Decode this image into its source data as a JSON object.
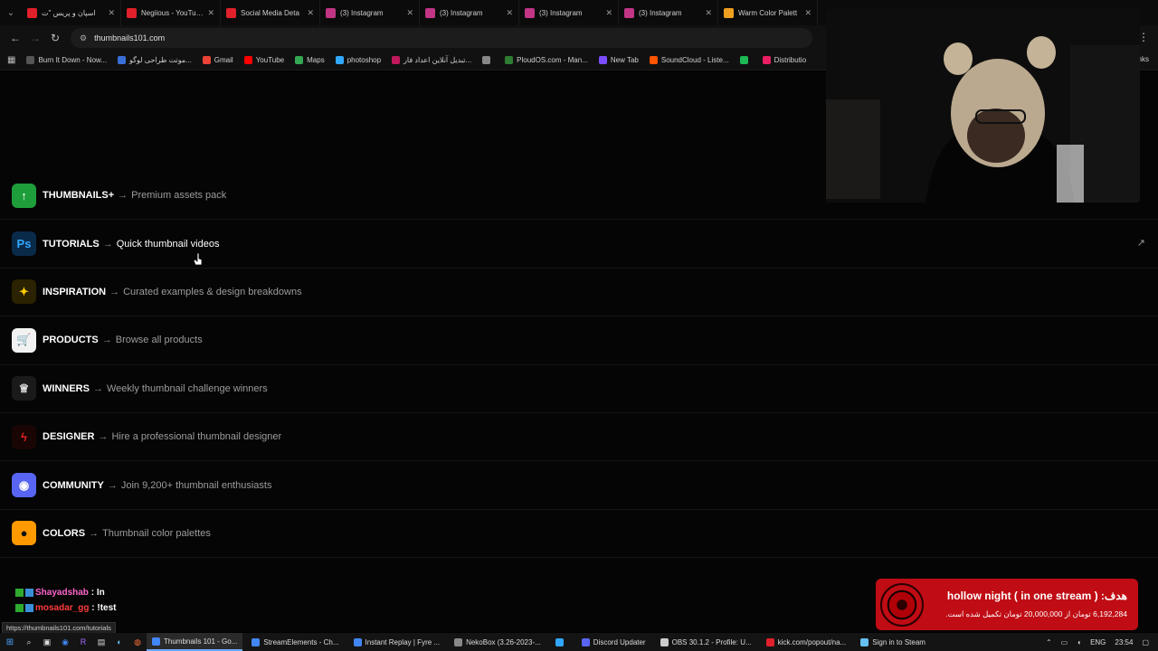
{
  "tabs": [
    {
      "label": "اسپان و پریس \"ت",
      "color": "#e0202a"
    },
    {
      "label": "Negiious - YouTube",
      "color": "#e0202a"
    },
    {
      "label": "Social Media Deta",
      "color": "#e0202a"
    },
    {
      "label": "(3) Instagram",
      "color": "#c13584"
    },
    {
      "label": "(3) Instagram",
      "color": "#c13584"
    },
    {
      "label": "(3) Instagram",
      "color": "#c13584"
    },
    {
      "label": "(3) Instagram",
      "color": "#c13584"
    },
    {
      "label": "Warm Color Palett",
      "color": "#f0a020"
    }
  ],
  "address": {
    "url": "thumbnails101.com"
  },
  "bookmarks": [
    {
      "label": "Burn It Down - Now...",
      "color": "#555"
    },
    {
      "label": "موتت طراحی لوگو...",
      "color": "#3a6fd8"
    },
    {
      "label": "Gmail",
      "color": "#ea4335"
    },
    {
      "label": "YouTube",
      "color": "#ff0000"
    },
    {
      "label": "Maps",
      "color": "#34a853"
    },
    {
      "label": "photoshop",
      "color": "#31a8ff"
    },
    {
      "label": "تبدیل آنلاین اعداد فار...",
      "color": "#c2185b"
    },
    {
      "label": "",
      "color": "#888"
    },
    {
      "label": "PloudOS.com - Man...",
      "color": "#2e7d32"
    },
    {
      "label": "New Tab",
      "color": "#7c4dff"
    },
    {
      "label": "SoundCloud - Liste...",
      "color": "#ff5500"
    },
    {
      "label": "",
      "color": "#1db954"
    },
    {
      "label": "Distributio",
      "color": "#e91e63"
    }
  ],
  "bookmarks_end": "Links",
  "nav": [
    {
      "title": "THUMBNAILS+",
      "desc": "Premium assets pack",
      "icon": "arrow-up-icon",
      "glyph": "↑",
      "bg": "#1e9e3a",
      "fg": "#ffffff"
    },
    {
      "title": "TUTORIALS",
      "desc": "Quick thumbnail videos",
      "icon": "photoshop-icon",
      "glyph": "Ps",
      "bg": "#0a2a4a",
      "fg": "#31a8ff"
    },
    {
      "title": "INSPIRATION",
      "desc": "Curated examples & design breakdowns",
      "icon": "sparkles-icon",
      "glyph": "✦",
      "bg": "#2a2200",
      "fg": "#ffcc00"
    },
    {
      "title": "PRODUCTS",
      "desc": "Browse all products",
      "icon": "cart-icon",
      "glyph": "🛒",
      "bg": "#f2f2f2",
      "fg": "#111111"
    },
    {
      "title": "WINNERS",
      "desc": "Weekly thumbnail challenge winners",
      "icon": "trophy-icon",
      "glyph": "♕",
      "bg": "#1a1a1a",
      "fg": "#e6e6e6"
    },
    {
      "title": "DESIGNER",
      "desc": "Hire a professional thumbnail designer",
      "icon": "bolt-icon",
      "glyph": "ϟ",
      "bg": "#1a0505",
      "fg": "#e02020"
    },
    {
      "title": "COMMUNITY",
      "desc": "Join 9,200+ thumbnail enthusiasts",
      "icon": "discord-icon",
      "glyph": "◉",
      "bg": "#5865f2",
      "fg": "#ffffff"
    },
    {
      "title": "COLORS",
      "desc": "Thumbnail color palettes",
      "icon": "color-wheel-icon",
      "glyph": "●",
      "bg": "#ff9900",
      "fg": "#111111"
    }
  ],
  "nav_arrow": "→",
  "external_link_glyph": "↗",
  "chat": [
    {
      "user": "Shayadshab",
      "msg": "In",
      "color": "#ff66cc"
    },
    {
      "user": "mosadar_gg",
      "msg": "!test",
      "color": "#ff3b3b"
    }
  ],
  "goal": {
    "title": "هدف: ( hollow night ( in one stream",
    "sub": "6,192,284 تومان از 20,000,000 تومان تکمیل شده است."
  },
  "status_url": "https://thumbnails101.com/tutorials",
  "taskbar_apps": [
    {
      "label": "Thumbnails 101 - Go...",
      "color": "#4285f4",
      "active": true
    },
    {
      "label": "StreamElements - Ch...",
      "color": "#4285f4",
      "active": false
    },
    {
      "label": "Instant Replay | Fyre ...",
      "color": "#4285f4",
      "active": false
    },
    {
      "label": "NekoBox (3.26-2023-...",
      "color": "#888888",
      "active": false
    },
    {
      "label": "",
      "color": "#31a8ff",
      "active": false
    },
    {
      "label": "Discord Updater",
      "color": "#5865f2",
      "active": false
    },
    {
      "label": "OBS 30.1.2 - Profile: U...",
      "color": "#cccccc",
      "active": false
    },
    {
      "label": "kick.com/popout/na...",
      "color": "#e0202a",
      "active": false
    },
    {
      "label": "Sign in to Steam",
      "color": "#66c0f4",
      "active": false
    }
  ],
  "tray": {
    "lang": "ENG",
    "time": "23:54"
  }
}
